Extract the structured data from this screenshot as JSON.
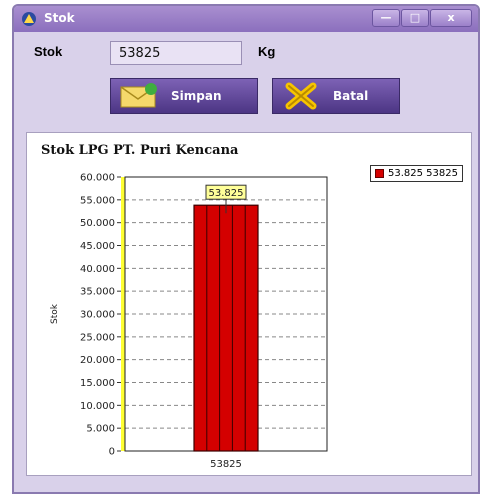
{
  "window": {
    "title": "Stok",
    "min_icon": "—",
    "max_icon": "□",
    "close_icon": "x"
  },
  "form": {
    "stok_label": "Stok",
    "stok_value": "53825",
    "unit": "Kg"
  },
  "buttons": {
    "save_label": "Simpan",
    "cancel_label": "Batal"
  },
  "colors": {
    "bar": "#d40000",
    "bar_edge": "#3a0000",
    "axis_highlight": "#ffff33",
    "window_bg": "#d9d1ea",
    "title_bar": "#8b6fbd"
  },
  "chart_data": {
    "type": "bar",
    "title": "Stok LPG PT. Puri Kencana",
    "ylabel": "Stok",
    "xlabel": "",
    "ylim": [
      0,
      60000
    ],
    "yticks": [
      "0",
      "5.000",
      "10.000",
      "15.000",
      "20.000",
      "25.000",
      "30.000",
      "35.000",
      "40.000",
      "45.000",
      "50.000",
      "55.000",
      "60.000"
    ],
    "categories": [
      "53825"
    ],
    "values": [
      53825
    ],
    "data_label": "53.825",
    "legend": [
      "53.825 53825"
    ],
    "legend_position": "top-right",
    "grid": true
  }
}
